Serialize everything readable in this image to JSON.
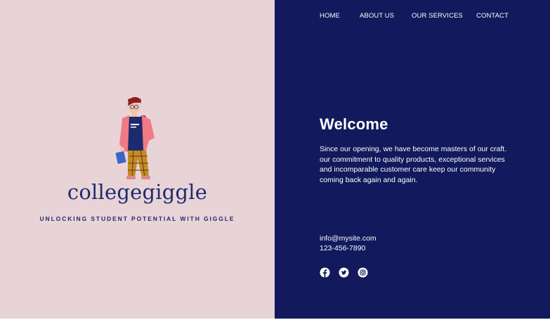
{
  "nav": {
    "items": [
      {
        "label": "HOME"
      },
      {
        "label": "ABOUT US"
      },
      {
        "label": "OUR SERVICES"
      },
      {
        "label": "CONTACT"
      }
    ]
  },
  "brand": {
    "name": "collegegiggle",
    "tagline": "UNLOCKING STUDENT POTENTIAL WITH GIGGLE"
  },
  "welcome": {
    "title": "Welcome",
    "text": "Since our opening, we have become masters of our craft. our commitment to quality products, exceptional services and incomparable customer care keep our community coming back again and again."
  },
  "contact": {
    "email": "info@mysite.com",
    "phone": "123-456-7890"
  },
  "social": [
    {
      "icon": "facebook-icon"
    },
    {
      "icon": "twitter-icon"
    },
    {
      "icon": "instagram-icon"
    }
  ],
  "colors": {
    "left_background": "#e8d3d6",
    "right_background": "#12195c",
    "brand_text": "#1f2c6d",
    "light_text": "#ffffff"
  }
}
